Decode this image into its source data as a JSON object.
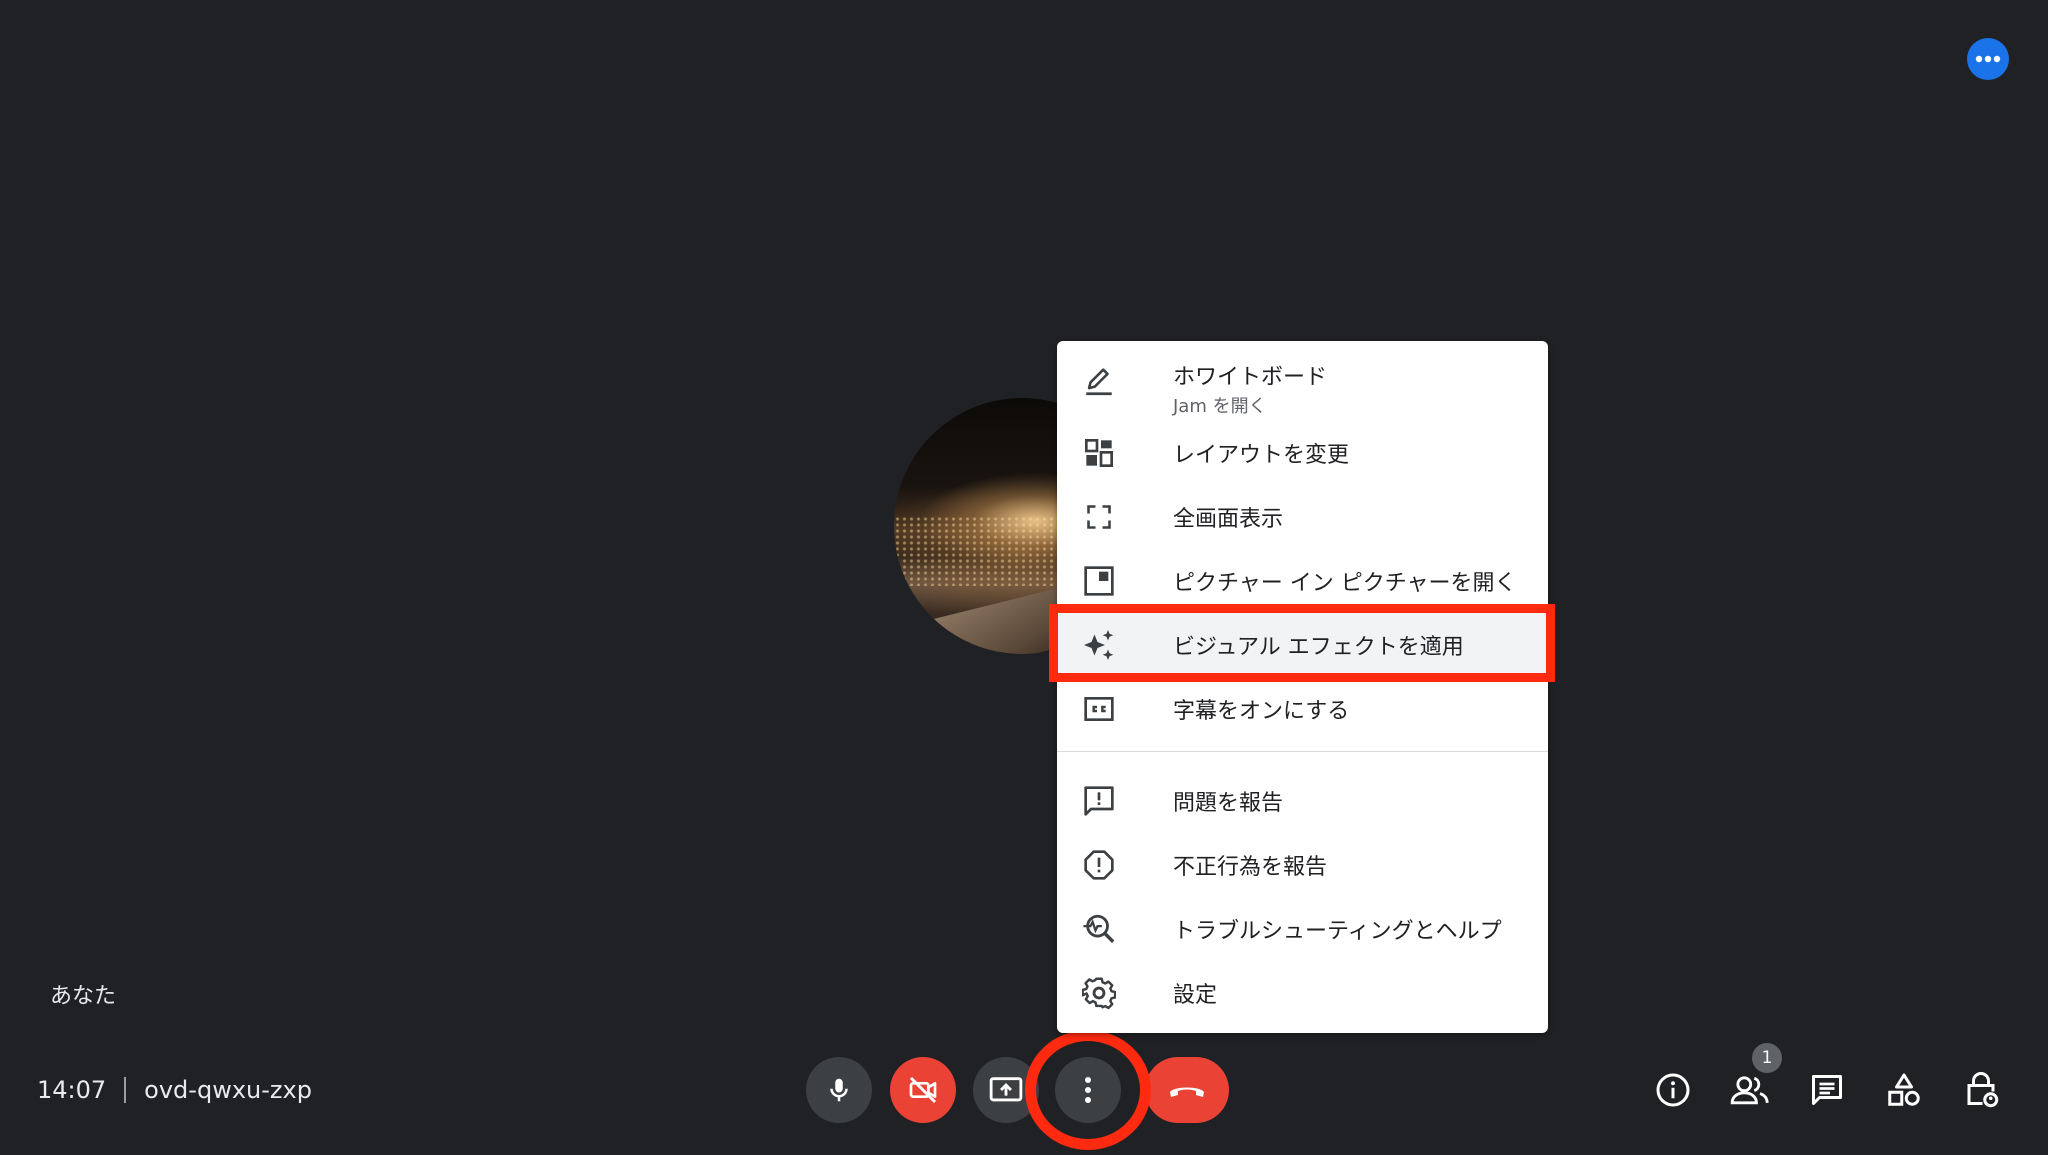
{
  "you_label": "あなた",
  "meeting": {
    "time": "14:07",
    "code": "ovd-qwxu-zxp"
  },
  "participants_count": "1",
  "menu": {
    "items": [
      {
        "label": "ホワイトボード",
        "sublabel": "Jam を開く",
        "icon": "pencil-icon"
      },
      {
        "label": "レイアウトを変更",
        "icon": "layout-icon"
      },
      {
        "label": "全画面表示",
        "icon": "fullscreen-icon"
      },
      {
        "label": "ピクチャー イン ピクチャーを開く",
        "icon": "picture-in-picture-icon"
      },
      {
        "label": "ビジュアル エフェクトを適用",
        "icon": "sparkle-icon"
      },
      {
        "label": "字幕をオンにする",
        "icon": "closed-caption-icon"
      },
      {
        "label": "問題を報告",
        "icon": "feedback-icon"
      },
      {
        "label": "不正行為を報告",
        "icon": "report-icon"
      },
      {
        "label": "トラブルシューティングとヘルプ",
        "icon": "troubleshoot-icon"
      },
      {
        "label": "設定",
        "icon": "settings-gear-icon"
      }
    ]
  },
  "colors": {
    "background": "#202124",
    "accent": "#1a73e8",
    "danger": "#ea4335",
    "annotation": "#ff2a10"
  }
}
